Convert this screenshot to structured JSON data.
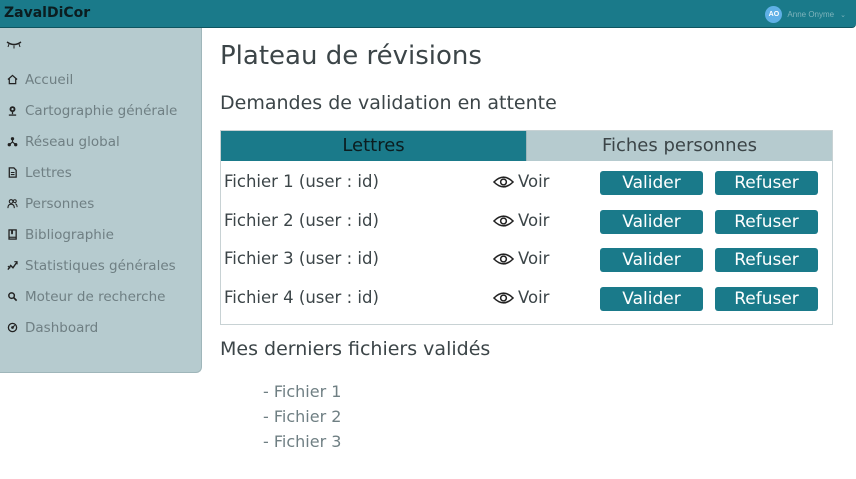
{
  "header": {
    "app_title": "ZavalDiCor",
    "user": {
      "initials": "AO",
      "name": "Anne Onyme"
    }
  },
  "sidebar": {
    "items": [
      {
        "label": "Accueil",
        "icon": "home-icon"
      },
      {
        "label": "Cartographie générale",
        "icon": "map-pin-icon"
      },
      {
        "label": "Réseau global",
        "icon": "network-icon"
      },
      {
        "label": "Lettres",
        "icon": "letter-icon"
      },
      {
        "label": "Personnes",
        "icon": "people-icon"
      },
      {
        "label": "Bibliographie",
        "icon": "book-icon"
      },
      {
        "label": "Statistiques générales",
        "icon": "chart-icon"
      },
      {
        "label": "Moteur de recherche",
        "icon": "search-icon"
      },
      {
        "label": "Dashboard",
        "icon": "dashboard-icon"
      }
    ]
  },
  "main": {
    "page_title": "Plateau de révisions",
    "pending_title": "Demandes de validation en attente",
    "tabs": [
      {
        "label": "Lettres",
        "active": true
      },
      {
        "label": "Fiches personnes",
        "active": false
      }
    ],
    "rows": [
      {
        "file": "Fichier 1 (user : id)",
        "view": "Voir",
        "validate": "Valider",
        "refuse": "Refuser"
      },
      {
        "file": "Fichier 2 (user : id)",
        "view": "Voir",
        "validate": "Valider",
        "refuse": "Refuser"
      },
      {
        "file": "Fichier 3 (user : id)",
        "view": "Voir",
        "validate": "Valider",
        "refuse": "Refuser"
      },
      {
        "file": "Fichier 4 (user : id)",
        "view": "Voir",
        "validate": "Valider",
        "refuse": "Refuser"
      }
    ],
    "recent_title": "Mes derniers fichiers validés",
    "recent_files": [
      "- Fichier 1",
      "- Fichier 2",
      "- Fichier 3"
    ]
  },
  "colors": {
    "accent": "#1a7a8a",
    "sidebar_bg": "#b6cbcf",
    "button_text": "#ffffff"
  }
}
